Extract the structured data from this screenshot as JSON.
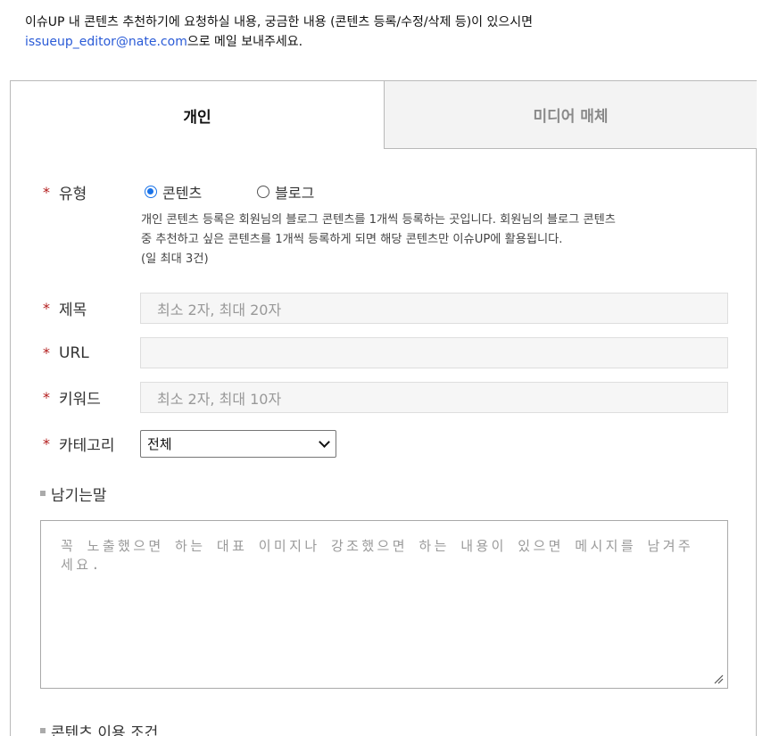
{
  "intro": {
    "line1": "이슈UP 내 콘텐츠 추천하기에 요청하실 내용, 궁금한 내용 (콘텐츠 등록/수정/삭제 등)이 있으시면",
    "email": "issueup_editor@nate.com",
    "line2_suffix": "으로 메일 보내주세요."
  },
  "tabs": [
    {
      "label": "개인"
    },
    {
      "label": "미디어 매체"
    }
  ],
  "form": {
    "required_mark": "*",
    "type": {
      "label": "유형",
      "options": [
        "콘텐츠",
        "블로그"
      ],
      "selected": "콘텐츠",
      "description_line1": "개인 콘텐츠 등록은 회원님의 블로그 콘텐츠를 1개씩 등록하는 곳입니다. 회원님의 블로그 콘텐츠",
      "description_line2": "중 추천하고 싶은 콘텐츠를 1개씩 등록하게 되면 해당 콘텐츠만 이슈UP에 활용됩니다.",
      "description_line3": "(일 최대 3건)"
    },
    "title": {
      "label": "제목",
      "placeholder": "최소 2자, 최대 20자",
      "value": ""
    },
    "url": {
      "label": "URL",
      "placeholder": "",
      "value": ""
    },
    "keyword": {
      "label": "키워드",
      "placeholder": "최소 2자, 최대 10자",
      "value": ""
    },
    "category": {
      "label": "카테고리",
      "selected": "전체"
    },
    "message": {
      "label": "남기는말",
      "placeholder": "꼭 노출했으면 하는 대표 이미지나 강조했으면 하는 내용이 있으면 메시지를 남겨주세요."
    },
    "terms": {
      "label": "콘텐츠 이용 조건"
    }
  },
  "colors": {
    "required_star": "#b31d1d",
    "link": "#2a5bd7",
    "radio_checked": "#1a73e8",
    "inactive_tab_bg": "#f3f3f3"
  }
}
